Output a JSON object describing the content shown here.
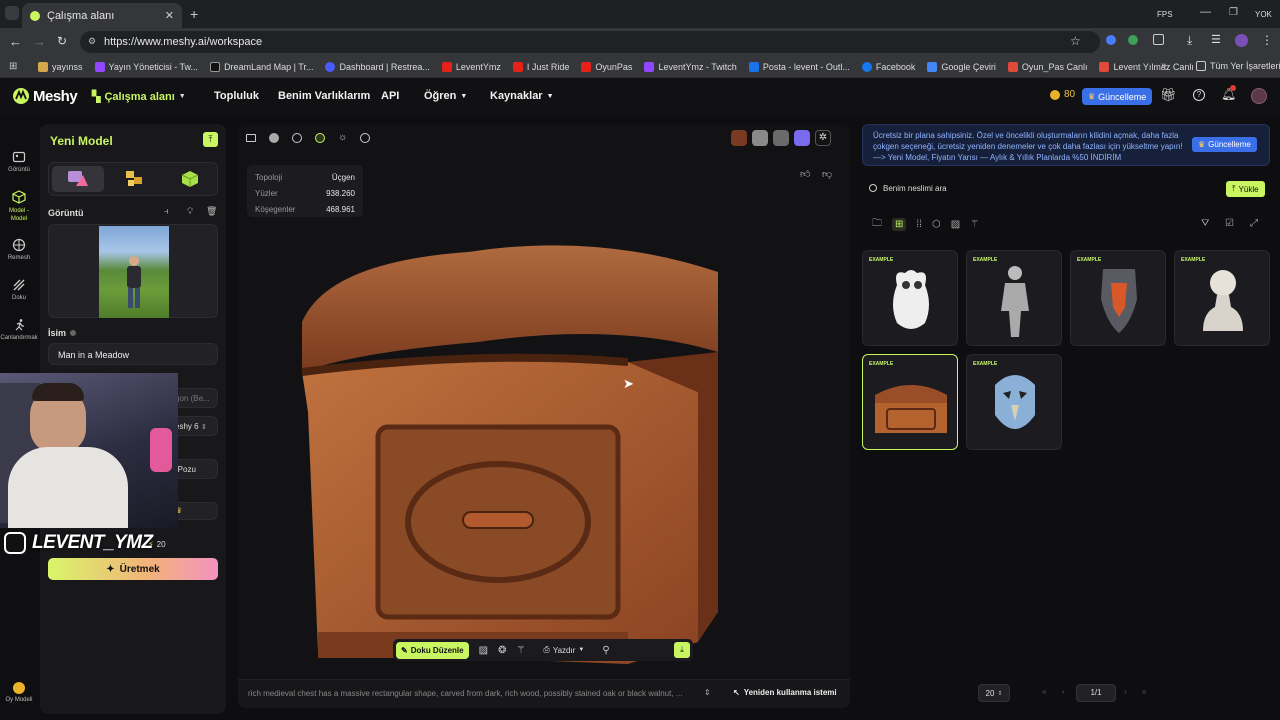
{
  "browser": {
    "tab_title": "Çalışma alanı",
    "url": "https://www.meshy.ai/workspace",
    "right_labels": [
      "FPS",
      "YOK"
    ],
    "bookmarks": [
      "yayınss",
      "Yayın Yöneticisi - Tw...",
      "DreamLand Map | Tr...",
      "Dashboard | Restrea...",
      "LeventYmz",
      "I Just Ride",
      "OyunPas",
      "LeventYmz - Twitch",
      "Posta - levent - Outl...",
      "Facebook",
      "Google Çeviri",
      "Oyun_Pas Canlı",
      "Levent Yılmaz Canlı"
    ],
    "all_bookmarks": "Tüm Yer İşaretleri"
  },
  "header": {
    "brand": "Meshy",
    "nav": [
      "Çalışma alanı",
      "Topluluk",
      "Benim Varlıklarım",
      "API",
      "Öğren",
      "Kaynaklar"
    ],
    "credits": "80",
    "upgrade": "Güncelleme"
  },
  "rail": {
    "items": [
      "Görüntü",
      "Model - Model",
      "Remesh",
      "Doku",
      "Canlandırmak"
    ],
    "bottom": "Oy Modeli"
  },
  "left_panel": {
    "title": "Yeni Model",
    "section_image": "Görüntü",
    "name_label": "İsim",
    "name_value": "Man in a Meadow",
    "partial_1": "gon (Be...",
    "partial_2": "eshy 6",
    "partial_3": "-Pozu",
    "credit_cost": "20",
    "generate": "Üretmek"
  },
  "webcam": {
    "handle": "LEVENT_YMZ"
  },
  "viewport": {
    "stats": [
      {
        "label": "Topoloji",
        "value": "Üçgen"
      },
      {
        "label": "Yüzler",
        "value": "938.260"
      },
      {
        "label": "Köşegenler",
        "value": "468.961"
      }
    ],
    "bottom_tools": {
      "texture_edit": "Doku Düzenle",
      "print": "Yazdır"
    },
    "prompt": "rich medieval chest has a massive rectangular shape, carved from dark, rich wood, possibly stained oak or black walnut, ...",
    "reuse": "Yeniden kullanma istemi"
  },
  "right": {
    "banner_line1": "Ücretsiz bir plana sahipsiniz. Özel ve öncelikli oluşturmaların kilidini açmak, daha fazla",
    "banner_line2": "çokgen seçeneği, ücretsiz yeniden denemeler ve çok daha fazlası için yükseltme yapın!",
    "banner_line3": "—> Yeni Model, Fiyatın Yarısı — Aylık & Yıllık Planlarda %50 İNDİRİM",
    "banner_button": "Güncelleme",
    "search_placeholder": "Benim neslimi ara",
    "upload": "Yükle",
    "cards": [
      "EXAMPLE",
      "EXAMPLE",
      "EXAMPLE",
      "EXAMPLE",
      "EXAMPLE",
      "EXAMPLE"
    ],
    "page_size": "20",
    "page": "1/1"
  }
}
